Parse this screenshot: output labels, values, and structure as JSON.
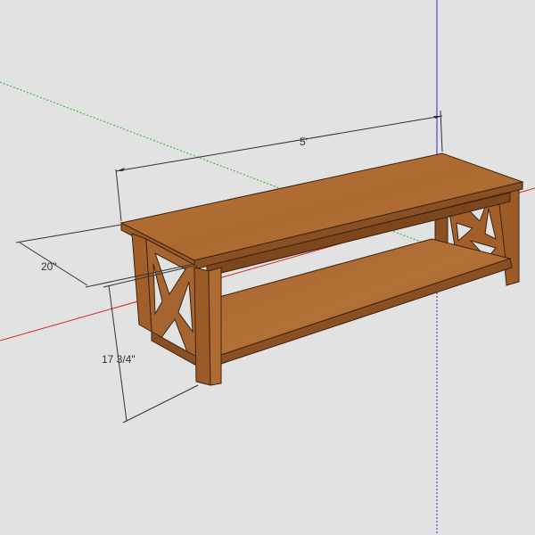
{
  "dimensions": {
    "length": "5'",
    "depth": "20\"",
    "height": "17 3/4\""
  },
  "colors": {
    "background": "#e2e2e2",
    "axis_red": "#d8261e",
    "axis_green": "#2eb02e",
    "axis_blue": "#2a2ad8",
    "dimension_line": "#333333",
    "wood_light": "#b8743a",
    "wood_mid": "#a6632b",
    "wood_dark": "#8a4f22",
    "edge": "#3a2410"
  },
  "icons": {
    "dimension_arrow": "arrow-tick-icon"
  }
}
